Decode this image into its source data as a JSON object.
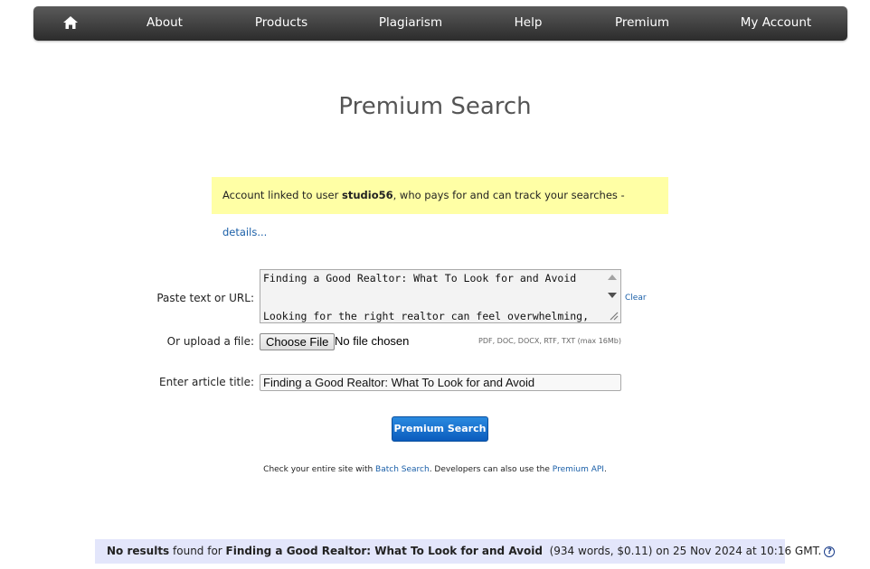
{
  "nav": {
    "home_icon": "home-icon",
    "items": [
      "About",
      "Products",
      "Plagiarism",
      "Help",
      "Premium",
      "My Account"
    ]
  },
  "page_title": "Premium Search",
  "notice": {
    "prefix": "Account linked to user ",
    "username": "studio56",
    "suffix": ", who pays for and can track your searches - ",
    "details_link": "details..."
  },
  "form": {
    "paste_label": "Paste text or URL:",
    "paste_lines": [
      "Finding a Good Realtor: What To Look for and Avoid",
      "",
      "Looking for the right realtor can feel overwhelming,"
    ],
    "clear_label": "Clear",
    "upload_label": "Or upload a file:",
    "choose_file_label": "Choose File",
    "no_file_label": "No file chosen",
    "file_types": "PDF, DOC, DOCX, RTF, TXT (max 16Mb)",
    "title_label": "Enter article title:",
    "title_value": "Finding a Good Realtor: What To Look for and Avoid",
    "search_button": "Premium Search"
  },
  "info": {
    "text1": "Check your entire site with ",
    "batch_link": "Batch Search",
    "text2": ". Developers can also use the ",
    "api_link": "Premium API",
    "text3": "."
  },
  "results": {
    "no_results": "No results",
    "found_for": " found for ",
    "query": "Finding a Good Realtor: What To Look for and Avoid",
    "details": "  (934 words, $0.11) on 25 Nov 2024 at 10:16 GMT.",
    "help_icon": "help-circle-icon"
  }
}
